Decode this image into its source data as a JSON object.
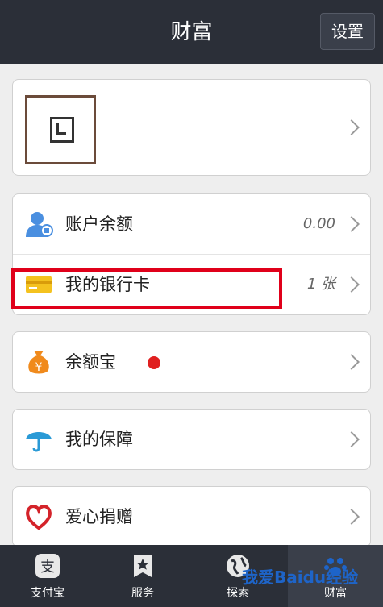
{
  "header": {
    "title": "财富",
    "settings_label": "设置"
  },
  "rows": {
    "balance": {
      "label": "账户余额",
      "value": "0.00"
    },
    "bank_card": {
      "label": "我的银行卡",
      "value": "1 张"
    },
    "yuebao": {
      "label": "余额宝"
    },
    "insurance": {
      "label": "我的保障"
    },
    "charity": {
      "label": "爱心捐赠"
    }
  },
  "tabs": [
    {
      "label": "支付宝",
      "icon": "alipay-icon"
    },
    {
      "label": "服务",
      "icon": "star-icon"
    },
    {
      "label": "探索",
      "icon": "globe-icon"
    },
    {
      "label": "财富",
      "icon": "wealth-icon"
    }
  ],
  "watermark": "我爱Baidu经验",
  "colors": {
    "header_bg": "#2b2f38",
    "highlight": "#e0001a",
    "yuebao_dot": "#e02020",
    "card_icon": "#f4c21f",
    "balance_icon": "#4a8fe0",
    "umbrella": "#2a9ad6",
    "heart": "#d4232a",
    "money_bag": "#f08a1c"
  }
}
